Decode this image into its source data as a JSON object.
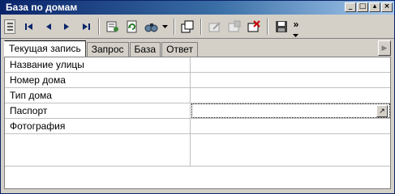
{
  "window": {
    "title": "База по домам",
    "controls": {
      "minimize": "_",
      "restore": "□",
      "maximize": "▴",
      "close": "×"
    }
  },
  "toolbar": {
    "overflow": "»",
    "buttons": [
      {
        "name": "grip",
        "icon": "grip-icon"
      },
      {
        "name": "first-record",
        "icon": "first-record-icon"
      },
      {
        "name": "prev-record",
        "icon": "prev-record-icon"
      },
      {
        "name": "next-record",
        "icon": "next-record-icon"
      },
      {
        "name": "last-record",
        "icon": "last-record-icon"
      },
      {
        "name": "properties",
        "icon": "properties-icon"
      },
      {
        "name": "refresh",
        "icon": "refresh-icon"
      },
      {
        "name": "find",
        "icon": "find-icon"
      },
      {
        "name": "new-window",
        "icon": "new-window-icon"
      },
      {
        "name": "edit-record",
        "icon": "edit-record-icon"
      },
      {
        "name": "add-record",
        "icon": "add-record-icon"
      },
      {
        "name": "delete-record",
        "icon": "delete-record-icon"
      },
      {
        "name": "save",
        "icon": "save-icon"
      }
    ]
  },
  "tabs": [
    {
      "label": "Текущая запись",
      "active": true
    },
    {
      "label": "Запрос",
      "active": false
    },
    {
      "label": "База",
      "active": false
    },
    {
      "label": "Ответ",
      "active": false
    }
  ],
  "tab_scroll": "▶",
  "fields": [
    {
      "label": "Название улицы",
      "value": ""
    },
    {
      "label": "Номер дома",
      "value": ""
    },
    {
      "label": "Тип дома",
      "value": ""
    },
    {
      "label": "Паспорт",
      "value": "",
      "focused": true,
      "button": "↗"
    },
    {
      "label": "Фотография",
      "value": ""
    },
    {
      "label": "",
      "value": ""
    }
  ],
  "colors": {
    "title_gradient_start": "#0a246a",
    "title_gradient_end": "#a6caf0",
    "face": "#d4d0c8",
    "nav_arrow": "#0a246a",
    "delete_red": "#cc0000"
  }
}
